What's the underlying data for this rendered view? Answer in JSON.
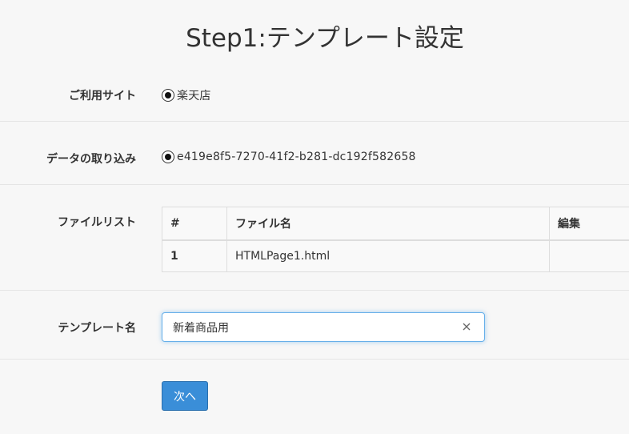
{
  "page": {
    "title": "Step1:テンプレート設定"
  },
  "site": {
    "label": "ご利用サイト",
    "option": "楽天店",
    "selected": true
  },
  "import": {
    "label": "データの取り込み",
    "option": "e419e8f5-7270-41f2-b281-dc192f582658",
    "selected": true
  },
  "files": {
    "label": "ファイルリスト",
    "headers": {
      "num": "#",
      "name": "ファイル名",
      "edit": "編集"
    },
    "rows": [
      {
        "num": "1",
        "name": "HTMLPage1.html",
        "edit": ""
      }
    ]
  },
  "template": {
    "label": "テンプレート名",
    "value": "新着商品用",
    "clear_icon": "close-icon"
  },
  "actions": {
    "next_label": "次へ",
    "accent_color": "#3a8ed8"
  }
}
